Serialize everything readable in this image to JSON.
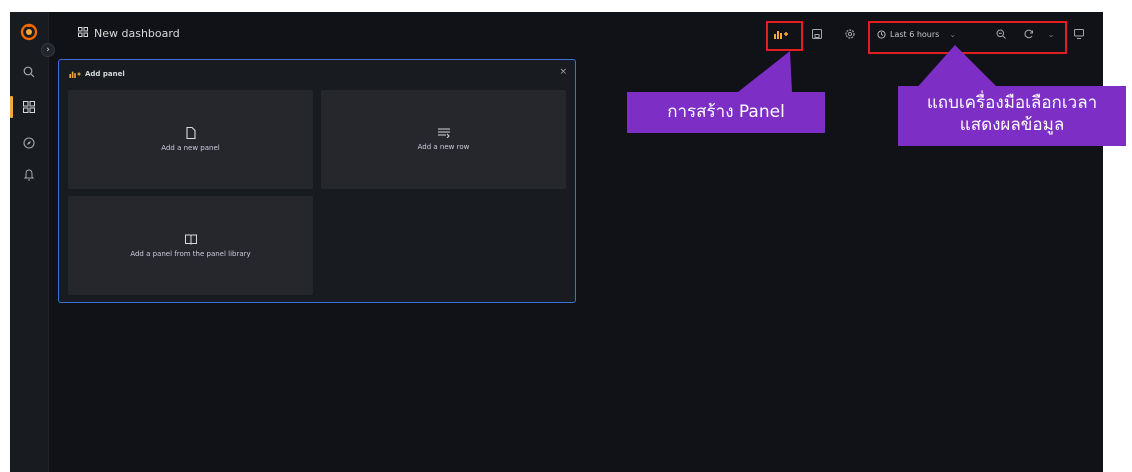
{
  "dashboard": {
    "title": "New dashboard"
  },
  "sidebar": {
    "items": [
      {
        "icon": "grafana-logo-icon"
      },
      {
        "icon": "search-icon"
      },
      {
        "icon": "dashboards-icon"
      },
      {
        "icon": "explore-icon"
      },
      {
        "icon": "alerting-bell-icon"
      }
    ],
    "expand_symbol": "›"
  },
  "toolbar": {
    "time_range": "Last 6 hours",
    "buttons": [
      "add-panel-icon",
      "save-icon",
      "settings-icon",
      "zoom-out-icon",
      "refresh-icon",
      "tv-mode-icon"
    ]
  },
  "add_panel": {
    "header": "Add panel",
    "close": "×",
    "options": [
      {
        "label": "Add a new panel",
        "icon": "file-icon"
      },
      {
        "label": "Add a new row",
        "icon": "rows-icon"
      },
      {
        "label": "Add a panel from the panel library",
        "icon": "library-book-icon"
      }
    ]
  },
  "annotations": {
    "create_panel": "การสร้าง Panel",
    "time_toolbar": [
      "แถบเครื่องมือเลือกเวลา",
      "แสดงผลข้อมูล"
    ]
  },
  "colors": {
    "background": "#111217",
    "panel_border": "#3d71d9",
    "annotation_red": "#e41e20",
    "callout_purple": "#7c2ec5",
    "brand_orange": "#f2a93b"
  }
}
